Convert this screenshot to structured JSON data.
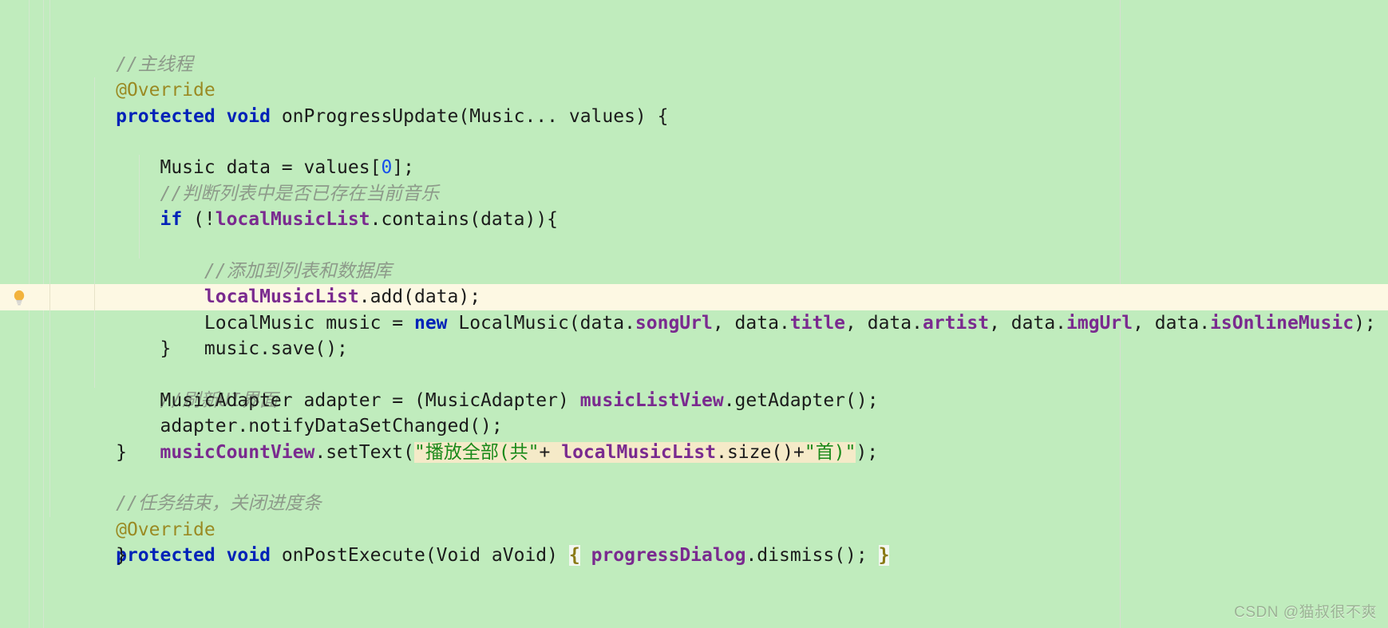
{
  "editor": {
    "language": "java",
    "background_color": "#c0ecbd",
    "current_line_color": "#fdf8e3",
    "string_highlight_color": "#f5eac8",
    "brace_highlight_color": "#f2f7f0",
    "indent_guide_color": "#d3e7cf",
    "right_margin_guide_color": "#d7ddd3",
    "colors": {
      "keyword": "#0022b8",
      "annotation": "#9a8a23",
      "comment": "#8d9a8a",
      "field": "#7a2a8f",
      "number": "#1750eb",
      "string": "#1a8a1a",
      "plain": "#1b1b1b",
      "brace_match": "#8a7a14"
    },
    "gutter": {
      "lightbulb_icon": "lightbulb-icon",
      "lightbulb_color": "#f2b33d"
    }
  },
  "lines": [
    {
      "id": 1,
      "text": "//主线程"
    },
    {
      "id": 2,
      "text": "@Override"
    },
    {
      "id": 3,
      "text": "protected void onProgressUpdate(Music... values) {"
    },
    {
      "id": 4,
      "text": "    Music data = values[0];"
    },
    {
      "id": 5,
      "text": "    //判断列表中是否已存在当前音乐"
    },
    {
      "id": 6,
      "text": "    if (!localMusicList.contains(data)){"
    },
    {
      "id": 7,
      "text": "        //添加到列表和数据库"
    },
    {
      "id": 8,
      "text": "        localMusicList.add(data);"
    },
    {
      "id": 9,
      "text": "        LocalMusic music = new LocalMusic(data.songUrl, data.title, data.artist, data.imgUrl, data.isOnlineMusic);"
    },
    {
      "id": 10,
      "text": "        music.save();"
    },
    {
      "id": 11,
      "text": "    }"
    },
    {
      "id": 12,
      "text": "    //刷新UI界面",
      "current": true
    },
    {
      "id": 13,
      "text": "    MusicAdapter adapter = (MusicAdapter) musicListView.getAdapter();"
    },
    {
      "id": 14,
      "text": "    adapter.notifyDataSetChanged();"
    },
    {
      "id": 15,
      "text": "    musicCountView.setText(\"播放全部(共\"+ localMusicList.size()+\"首)\");"
    },
    {
      "id": 16,
      "text": "}"
    },
    {
      "id": 17,
      "text": ""
    },
    {
      "id": 18,
      "text": "//任务结束，关闭进度条"
    },
    {
      "id": 19,
      "text": "@Override"
    },
    {
      "id": 20,
      "text": "protected void onPostExecute(Void aVoid) { progressDialog.dismiss(); }"
    },
    {
      "id": 21,
      "text": "}"
    }
  ],
  "tokens": {
    "comment_main_thread": "//主线程",
    "annotation_override_1": "@Override",
    "kw_protected_1": "protected",
    "kw_void_1": "void",
    "sig_on_progress_update": " onProgressUpdate(Music... values) {",
    "music_data_values": "    Music data = values[",
    "num_zero": "0",
    "close_bracket_semi": "];",
    "comment_check_list": "    //判断列表中是否已存在当前音乐",
    "kw_if": "if",
    "if_open_paren_bang": " (!",
    "fld_local_music_list_1": "localMusicList",
    "contains_data": ".contains(data)){",
    "comment_add_to_list": "        //添加到列表和数据库",
    "fld_local_music_list_2": "localMusicList",
    "add_data": ".add(data);",
    "local_music_decl": "        LocalMusic music = ",
    "kw_new": "new",
    "ctor_open": " LocalMusic(data.",
    "fld_song_url": "songUrl",
    "sep_1": ", data.",
    "fld_title": "title",
    "sep_2": ", data.",
    "fld_artist": "artist",
    "sep_3": ", data.",
    "fld_img_url": "imgUrl",
    "sep_4": ", data.",
    "fld_is_online_music": "isOnlineMusic",
    "ctor_close": ");",
    "music_save": "        music.save();",
    "close_brace_inner": "    }",
    "comment_refresh_ui": "    //刷新UI界面",
    "music_adapter_decl": "    MusicAdapter adapter = (MusicAdapter) ",
    "fld_music_list_view": "musicListView",
    "get_adapter": ".getAdapter();",
    "notify_changed": "    adapter.notifyDataSetChanged();",
    "indent_4": "    ",
    "fld_music_count_view": "musicCountView",
    "set_text_open": ".setText(",
    "str_play_all": "\"播放全部(共\"",
    "plus_1": "+ ",
    "fld_local_music_list_3": "localMusicList",
    "size_call": ".size()+",
    "str_shou": "\"首)\"",
    "set_text_close": ");",
    "close_brace_method": "}",
    "comment_task_done": "//任务结束，关闭进度条",
    "annotation_override_2": "@Override",
    "kw_protected_2": "protected",
    "kw_void_2": "void",
    "sig_on_post_execute": " onPostExecute(Void aVoid) ",
    "brace_open_match": "{",
    "space_1": " ",
    "fld_progress_dialog": "progressDialog",
    "dismiss_call": ".dismiss(); ",
    "brace_close_match": "}",
    "close_brace_class": "}"
  },
  "watermark": {
    "text": "CSDN @猫叔很不爽"
  }
}
